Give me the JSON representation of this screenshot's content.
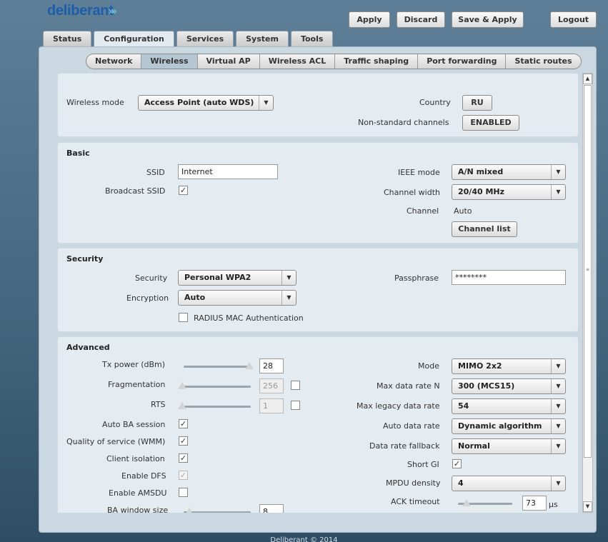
{
  "brand": {
    "name": "deliberant",
    "arrows": "»»"
  },
  "header_buttons": {
    "apply": "Apply",
    "discard": "Discard",
    "save_apply": "Save & Apply",
    "logout": "Logout"
  },
  "main_tabs": [
    "Status",
    "Configuration",
    "Services",
    "System",
    "Tools"
  ],
  "active_main_tab": "Configuration",
  "sub_tabs": [
    "Network",
    "Wireless",
    "Virtual AP",
    "Wireless ACL",
    "Traffic shaping",
    "Port forwarding",
    "Static routes"
  ],
  "active_sub_tab": "Wireless",
  "general": {
    "wireless_mode_label": "Wireless mode",
    "wireless_mode_value": "Access Point (auto WDS)",
    "country_label": "Country",
    "country_value": "RU",
    "nonstd_label": "Non-standard channels",
    "nonstd_value": "ENABLED"
  },
  "basic": {
    "title": "Basic",
    "ssid_label": "SSID",
    "ssid_value": "Internet",
    "broadcast_label": "Broadcast SSID",
    "broadcast_checked": true,
    "ieee_label": "IEEE mode",
    "ieee_value": "A/N mixed",
    "width_label": "Channel width",
    "width_value": "20/40 MHz",
    "channel_label": "Channel",
    "channel_value": "Auto",
    "channel_list_button": "Channel list"
  },
  "security": {
    "title": "Security",
    "security_label": "Security",
    "security_value": "Personal WPA2",
    "encryption_label": "Encryption",
    "encryption_value": "Auto",
    "radius_label": "RADIUS MAC Authentication",
    "radius_checked": false,
    "passphrase_label": "Passphrase",
    "passphrase_value": "********"
  },
  "advanced": {
    "title": "Advanced",
    "tx_label": "Tx power (dBm)",
    "tx_value": "28",
    "tx_level": 1.0,
    "frag_label": "Fragmentation",
    "frag_value": "256",
    "frag_level": 0.0,
    "rts_label": "RTS",
    "rts_value": "1",
    "rts_level": 0.0,
    "auto_ba_label": "Auto BA session",
    "qos_label": "Quality of service (WMM)",
    "isolation_label": "Client isolation",
    "dfs_label": "Enable DFS",
    "amsdu_label": "Enable AMSDU",
    "ba_label": "BA window size",
    "ba_value": "8",
    "mode_label": "Mode",
    "mode_value": "MIMO 2x2",
    "max_n_label": "Max data rate N",
    "max_n_value": "300 (MCS15)",
    "max_legacy_label": "Max legacy data rate",
    "max_legacy_value": "54",
    "auto_rate_label": "Auto data rate",
    "auto_rate_value": "Dynamic algorithm",
    "fallback_label": "Data rate fallback",
    "fallback_value": "Normal",
    "short_gi_label": "Short GI",
    "mpdu_label": "MPDU density",
    "mpdu_value": "4",
    "ack_label": "ACK timeout",
    "ack_value": "73",
    "ack_unit": "μs"
  },
  "check_mark": "✓",
  "arrow": "▼",
  "footer": "Deliberant © 2014"
}
